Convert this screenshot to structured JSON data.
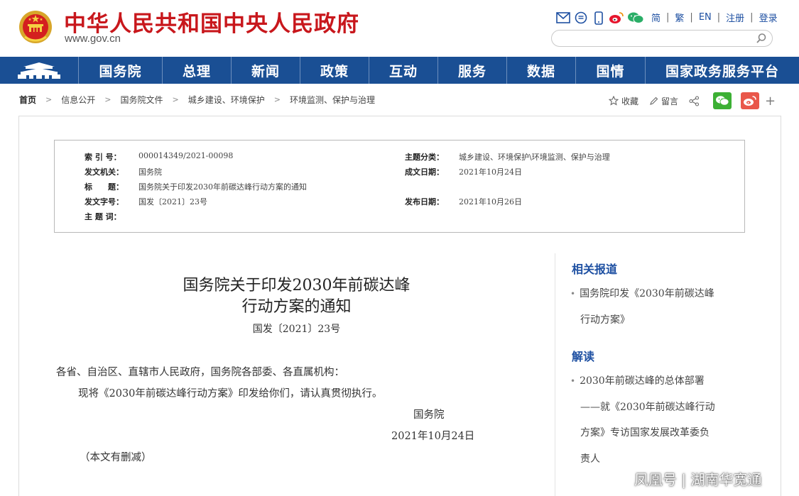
{
  "header": {
    "site_title": "中华人民共和国中央人民政府",
    "site_url": "www.gov.cn",
    "top_links": [
      "简",
      "繁",
      "EN",
      "注册",
      "登录"
    ],
    "search": {
      "placeholder": ""
    }
  },
  "nav": {
    "items": [
      "国务院",
      "总理",
      "新闻",
      "政策",
      "互动",
      "服务",
      "数据",
      "国情",
      "国家政务服务平台"
    ]
  },
  "breadcrumb": [
    "首页",
    "信息公开",
    "国务院文件",
    "城乡建设、环境保护",
    "环境监测、保护与治理"
  ],
  "share": {
    "favorite": "收藏",
    "comment": "留言",
    "more": "+"
  },
  "meta": {
    "index_label": "索 引 号：",
    "index_value": "000014349/2021-00098",
    "category_label": "主题分类：",
    "category_value": "城乡建设、环境保护\\环境监测、保护与治理",
    "issuer_label": "发文机关：",
    "issuer_value": "国务院",
    "written_label": "成文日期：",
    "written_value": "2021年10月24日",
    "title_label": "标　　题：",
    "title_value": "国务院关于印发2030年前碳达峰行动方案的通知",
    "docno_label": "发文字号：",
    "docno_value": "国发〔2021〕23号",
    "published_label": "发布日期：",
    "published_value": "2021年10月26日",
    "keywords_label": "主 题 词：",
    "keywords_value": ""
  },
  "article": {
    "title_line1": "国务院关于印发2030年前碳达峰",
    "title_line2": "行动方案的通知",
    "doc_number": "国发〔2021〕23号",
    "salutation": "各省、自治区、直辖市人民政府，国务院各部委、各直属机构：",
    "body": "现将《2030年前碳达峰行动方案》印发给你们，请认真贯彻执行。",
    "signature": "国务院",
    "date": "2021年10月24日",
    "note": "（本文有删减）"
  },
  "sidebar": {
    "related_heading": "相关报道",
    "related_item_l1": "国务院印发《2030年前碳达峰",
    "related_item_l2": "行动方案》",
    "interpret_heading": "解读",
    "interpret_item_l1": "2030年前碳达峰的总体部署",
    "interpret_item_l2": "——就《2030年前碳达峰行动",
    "interpret_item_l3": "方案》专访国家发展改革委负",
    "interpret_item_l4": "责人"
  },
  "watermark": "凤凰号 | 湖南华宽通",
  "colors": {
    "brand_red": "#c8171c",
    "nav_blue": "#1a4f94",
    "link_blue": "#1e50a2"
  }
}
